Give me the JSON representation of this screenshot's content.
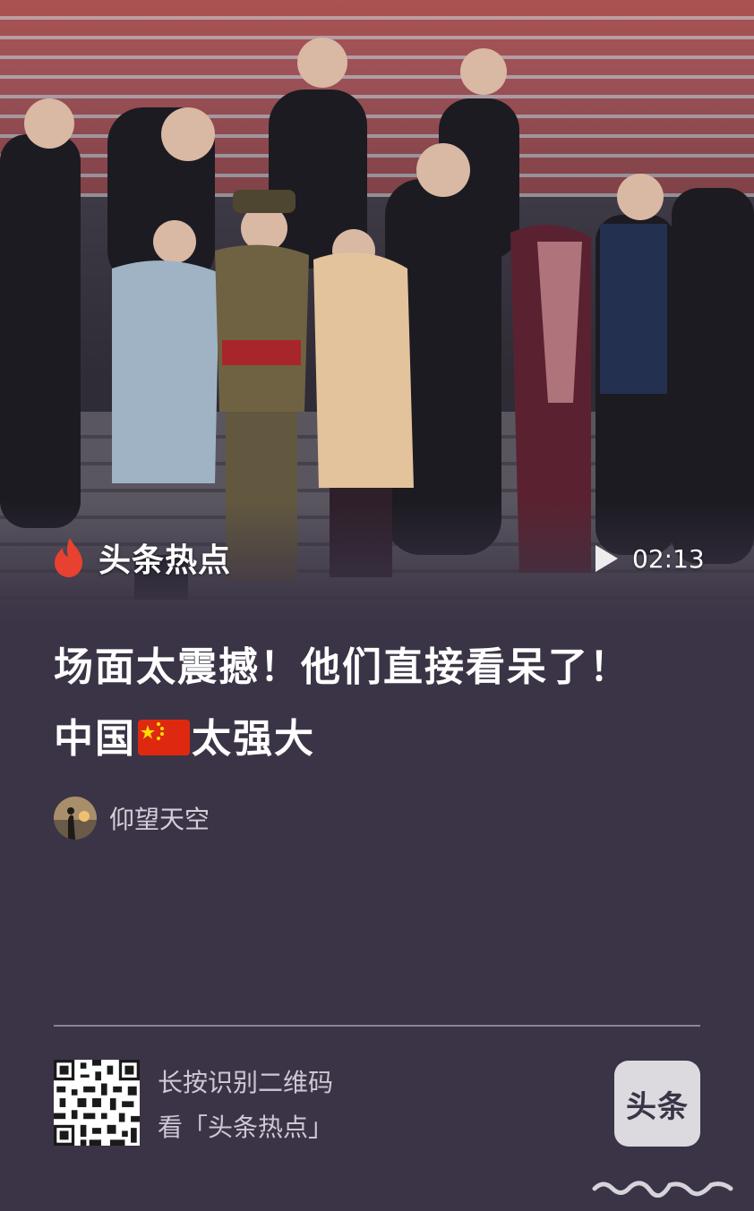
{
  "video": {
    "channel_name": "头条热点",
    "duration": "02:13"
  },
  "article": {
    "title_part1": "场面太震撼！他们直接看呆了！中国",
    "title_flag": "🇨🇳",
    "title_part2": "太强大"
  },
  "author": {
    "name": "仰望天空"
  },
  "footer": {
    "qr_line1": "长按识别二维码",
    "qr_line2": "看「头条热点」",
    "logo_text": "头条"
  },
  "colors": {
    "background": "#3b3446",
    "flame": "#e8412f",
    "text": "#ffffff",
    "muted_text": "#cdc8d4"
  },
  "icons": [
    "flame-icon",
    "play-icon",
    "qr-code",
    "toutiao-logo"
  ]
}
